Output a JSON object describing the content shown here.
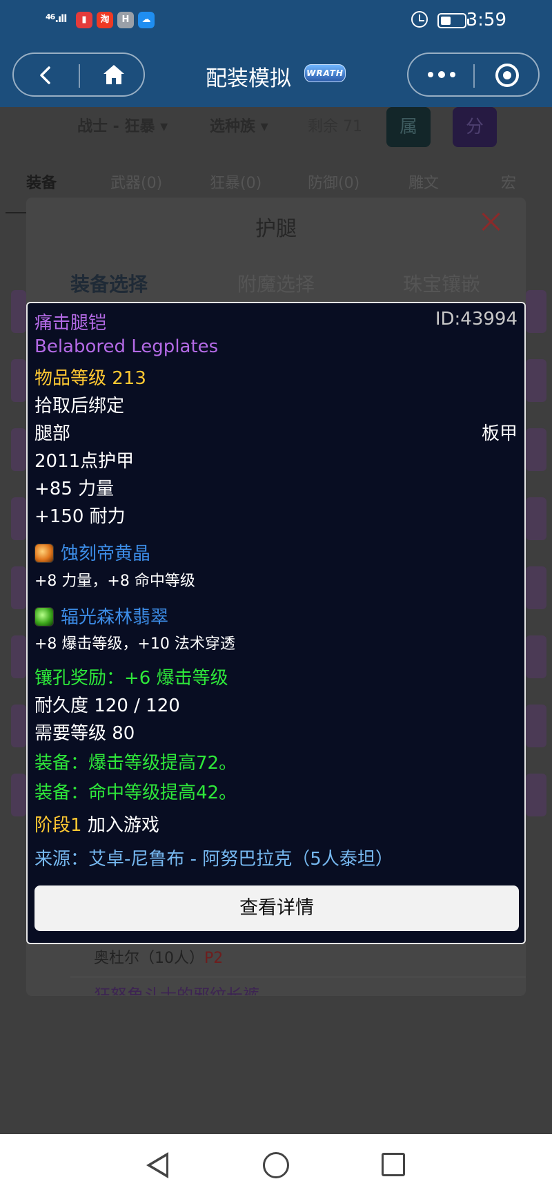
{
  "status_bar": {
    "signal": "46",
    "time": "3:59",
    "apps": [
      {
        "name": "red-book-icon",
        "glyph": "▮",
        "color": "#e43b3b"
      },
      {
        "name": "taobao-icon",
        "glyph": "淘",
        "color": "#ee3a24"
      },
      {
        "name": "huawei-icon",
        "glyph": "H",
        "color": "#9aa0a8"
      },
      {
        "name": "weather-icon",
        "glyph": "☁",
        "color": "#1f8ef1"
      }
    ]
  },
  "header": {
    "title": "配装模拟",
    "logo_text": "WRATH"
  },
  "background": {
    "class_select": "战士 - 狂暴",
    "race_select": "选种族",
    "remaining": "剩余 71",
    "attr_button": "属",
    "score_button": "分",
    "tabs": [
      "装备",
      "武器(0)",
      "狂暴(0)",
      "防御(0)",
      "雕文",
      "宏"
    ]
  },
  "modal": {
    "title": "护腿",
    "tabs": [
      "装备选择",
      "附魔选择",
      "珠宝镶嵌"
    ],
    "under_row1": {
      "text": "奥杜尔（10人）",
      "phase": "P2"
    },
    "under_row2": "狂怒角斗士的邪纹长裤"
  },
  "tooltip": {
    "name_cn": "痛击腿铠",
    "id": "ID:43994",
    "name_en": "Belabored Legplates",
    "item_level": "物品等级 213",
    "bind": "拾取后绑定",
    "slot": "腿部",
    "armor_type": "板甲",
    "armor": "2011点护甲",
    "stats": [
      "+85 力量",
      "+150 耐力"
    ],
    "gems": [
      {
        "name": "蚀刻帝黄晶",
        "effect": "+8 力量，+8 命中等级",
        "icon": "amber-gem-icon"
      },
      {
        "name": "辐光森林翡翠",
        "effect": "+8 爆击等级，+10 法术穿透",
        "icon": "green-gem-icon"
      }
    ],
    "socket_bonus": "镶孔奖励：+6 爆击等级",
    "durability": "耐久度 120 / 120",
    "required_level": "需要等级 80",
    "equip_effects": [
      "装备：爆击等级提高72。",
      "装备：命中等级提高42。"
    ],
    "phase_label": "阶段1",
    "phase_text": "加入游戏",
    "source": "来源：艾卓-尼鲁布 - 阿努巴拉克（5人泰坦）",
    "detail_button": "查看详情"
  }
}
